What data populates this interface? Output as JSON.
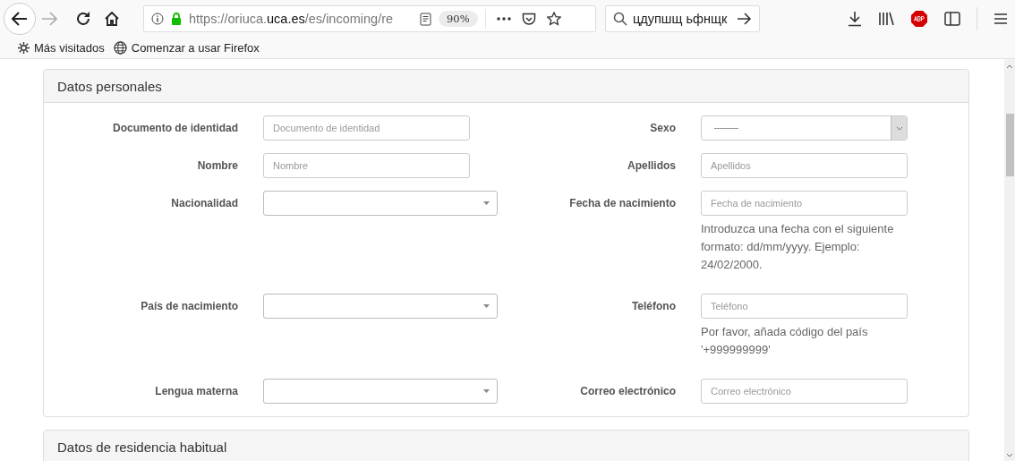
{
  "browser": {
    "back_enabled": true,
    "forward_enabled": false,
    "url": "https://oriuca.**uca.es**/es/incoming/re",
    "zoom": "90%",
    "search": "цдупшщ ьфнщк"
  },
  "bookmarks": [
    {
      "kind": "gear",
      "label": "Más visitados"
    },
    {
      "kind": "globe",
      "label": "Comenzar a usar Firefox"
    }
  ],
  "panels": [
    {
      "title": "Datos personales",
      "rows": [
        {
          "left": {
            "label": "Documento de identidad",
            "kind": "text",
            "placeholder": "Documento de identidad"
          },
          "right": {
            "label": "Sexo",
            "kind": "native-select",
            "value": "---------"
          }
        },
        {
          "left": {
            "label": "Nombre",
            "kind": "text",
            "placeholder": "Nombre"
          },
          "right": {
            "label": "Apellidos",
            "kind": "text",
            "placeholder": "Apellidos"
          }
        },
        {
          "left": {
            "label": "Nacionalidad",
            "kind": "select"
          },
          "right": {
            "label": "Fecha de nacimiento",
            "kind": "text",
            "placeholder": "Fecha de nacimiento",
            "help": "Introduzca una fecha con el siguiente formato: dd/mm/yyyy. Ejemplo: 24/02/2000."
          }
        },
        {
          "left": {
            "label": "País de nacimiento",
            "kind": "select"
          },
          "right": {
            "label": "Teléfono",
            "kind": "text",
            "placeholder": "Teléfono",
            "help": "Por favor, añada código del país '+999999999'"
          }
        },
        {
          "left": {
            "label": "Lengua materna",
            "kind": "select"
          },
          "right": {
            "label": "Correo electrónico",
            "kind": "text",
            "placeholder": "Correo electrónico"
          }
        }
      ]
    },
    {
      "title": "Datos de residencia habitual"
    }
  ]
}
